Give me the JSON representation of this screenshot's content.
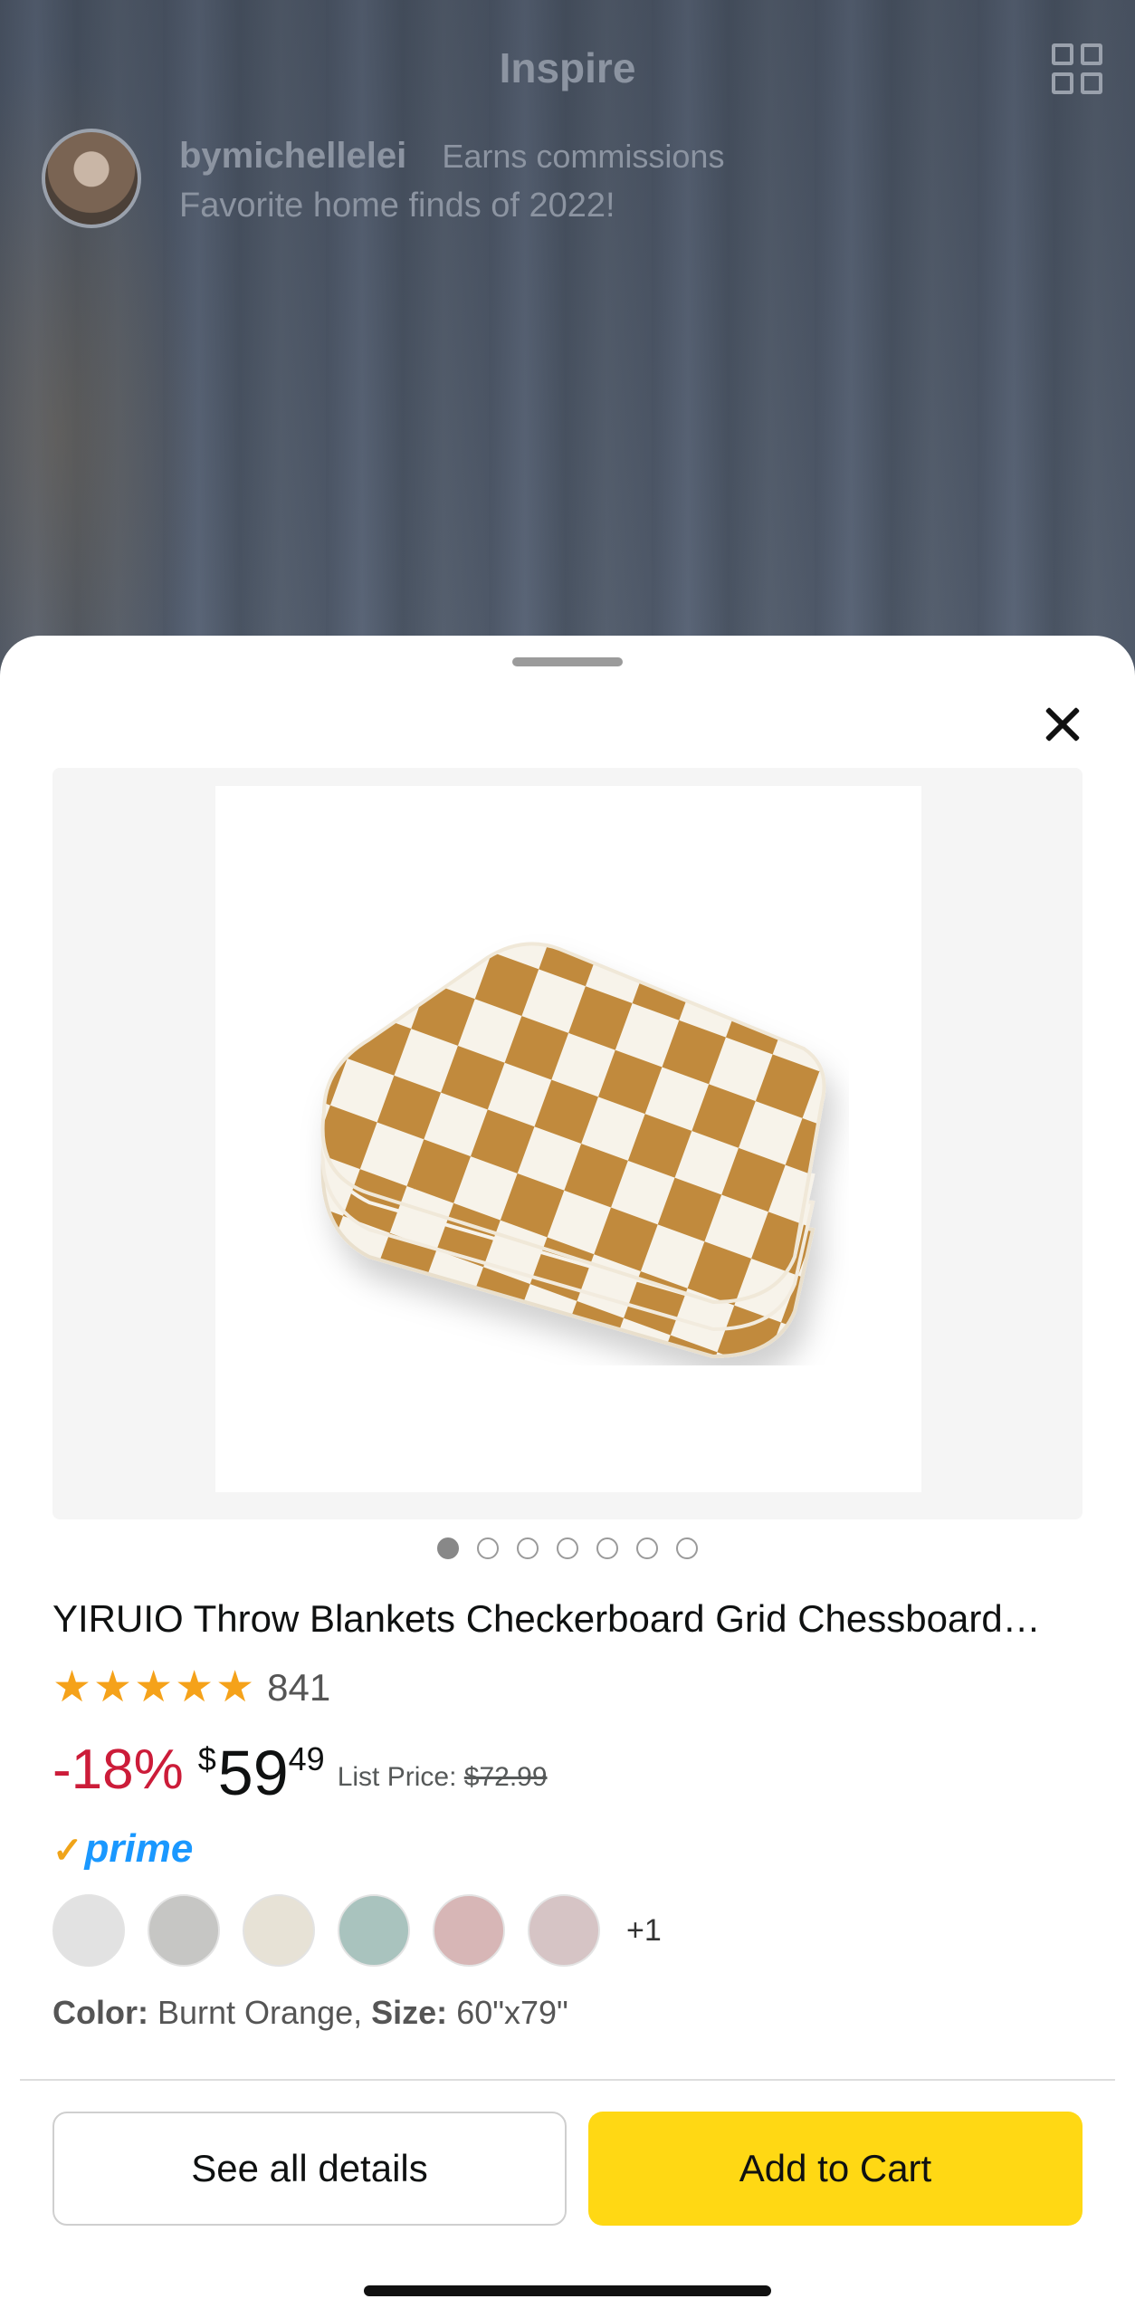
{
  "background": {
    "title": "Inspire",
    "creator": {
      "name": "bymichellelei",
      "badge": "Earns commissions",
      "caption": "Favorite home finds of 2022!"
    },
    "icons": [
      "grid-view-icon",
      "avatar"
    ]
  },
  "product": {
    "title": "YIRUIO Throw Blankets Checkerboard Grid Chessboard…",
    "rating": 5,
    "rating_count": "841",
    "discount": "-18%",
    "price_currency": "$",
    "price_whole": "59",
    "price_fraction": "49",
    "list_price_label": "List Price:",
    "list_price_value": "$72.99",
    "prime_label": "prime",
    "image_count": 7,
    "active_image": 1,
    "swatches": [
      "#e2e2e2",
      "#c6c6c4",
      "#e7e2d6",
      "#a9c3be",
      "#d7b6b6",
      "#d6c4c5"
    ],
    "swatches_more": "+1",
    "color_label": "Color:",
    "color_value": "Burnt Orange,",
    "size_label": "Size:",
    "size_value": "60\"x79\""
  },
  "actions": {
    "details_label": "See all details",
    "cart_label": "Add to Cart"
  },
  "colors": {
    "discount": "#cc1c39",
    "star": "#f5a21a",
    "prime": "#1a98ff",
    "cart_button": "#ffd814"
  }
}
